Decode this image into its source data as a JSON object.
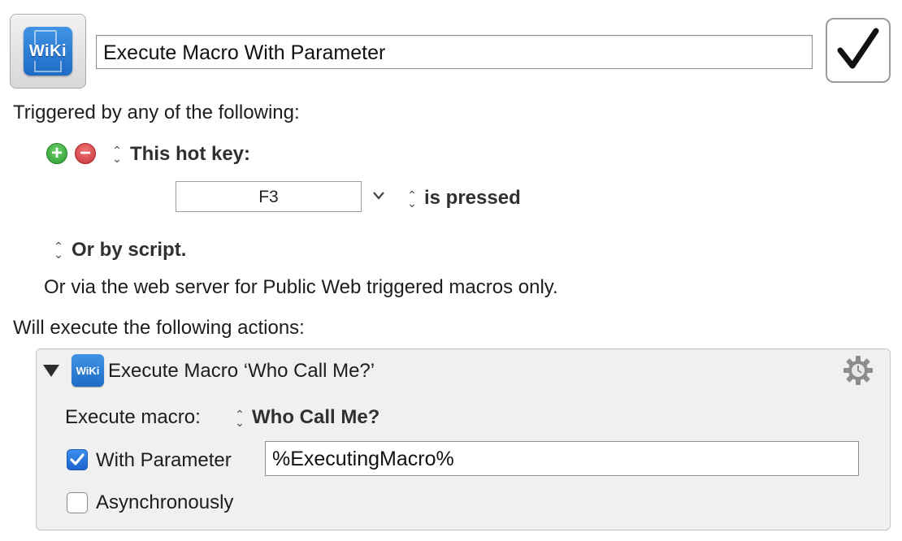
{
  "macro": {
    "icon": "wiki-icon",
    "icon_label": "WiKi",
    "name": "Execute Macro With Parameter",
    "enabled": true
  },
  "triggers": {
    "heading": "Triggered by any of the following:",
    "hotkey": {
      "label": "This hot key:",
      "key": "F3",
      "condition": "is pressed"
    },
    "script_label": "Or by script.",
    "web_server_text": "Or via the web server for Public Web triggered macros only."
  },
  "actions": {
    "heading": "Will execute the following actions:",
    "items": [
      {
        "icon_label": "WiKi",
        "title": "Execute Macro ‘Who Call Me?’",
        "execute_macro_label": "Execute macro:",
        "execute_macro_value": "Who Call Me?",
        "with_parameter_label": "With Parameter",
        "with_parameter_checked": true,
        "parameter_value": "%ExecutingMacro%",
        "asynchronously_label": "Asynchronously",
        "asynchronously_checked": false
      }
    ]
  },
  "colors": {
    "accent_blue": "#1d63cf",
    "add_green": "#2f9a33",
    "remove_red": "#c8343c"
  }
}
